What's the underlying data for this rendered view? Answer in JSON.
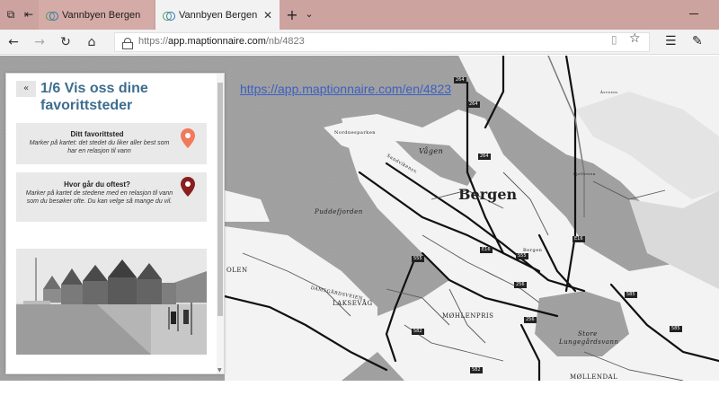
{
  "browser": {
    "tabs": [
      {
        "label": "Vannbyen Bergen",
        "active": false
      },
      {
        "label": "Vannbyen Bergen",
        "active": true
      }
    ],
    "new_tab_icon": "+",
    "tab_menu_icon": "⌄",
    "url_host": "app.maptionnaire.com",
    "url_path": "/nb/4823",
    "url_scheme": "https://"
  },
  "map": {
    "overlay_link": "https://app.maptionnaire.com/en/4823",
    "labels": {
      "city": "Bergen",
      "vagen": "Vågen",
      "puddefjorden": "Puddefjorden",
      "laksevag": "LAKSEVÅG",
      "mohlenpris": "MØHLENPRIS",
      "store": "Store",
      "lungegardsvann": "Lungegårdsvann",
      "mollendal": "MØLLENDAL",
      "nordnesparken": "Nordnesparken",
      "damsgardsveien": "DAMSGÅRDSVEIEN",
      "olen": "OLEN",
      "bergen_small": "Bergen",
      "fjellveien": "Fjellveien",
      "sandviken": "Sandvikensv.",
      "aarstad": "Åsveien"
    },
    "road_numbers": [
      "264",
      "264",
      "264",
      "555",
      "E16",
      "256",
      "555",
      "582",
      "582",
      "256",
      "E16",
      "585",
      "585",
      "585"
    ]
  },
  "panel": {
    "collapse_icon": "«",
    "title": "1/6 Vis oss dine favorittsteder",
    "cards": [
      {
        "title": "Ditt favorittsted",
        "description": "Marker på kartet: det stedet du liker aller best som har en relasjon til vann",
        "pin_color": "#f07a5b"
      },
      {
        "title": "Hvor går du oftest?",
        "description": "Marker på kartet de stedene med en relasjon til vann som du besøker ofte. Du kan velge så mange du vil.",
        "pin_color": "#8a1e1e"
      }
    ]
  }
}
